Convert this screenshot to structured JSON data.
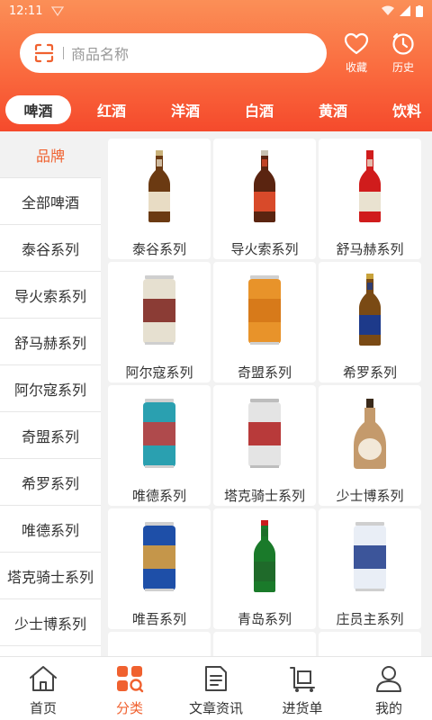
{
  "status_bar": {
    "time": "12:11"
  },
  "search": {
    "placeholder": "商品名称"
  },
  "top_actions": {
    "favorites": "收藏",
    "history": "历史"
  },
  "tabs": [
    {
      "label": "啤酒",
      "active": true
    },
    {
      "label": "红酒"
    },
    {
      "label": "洋酒"
    },
    {
      "label": "白酒"
    },
    {
      "label": "黄酒"
    },
    {
      "label": "饮料"
    }
  ],
  "sidenav": [
    {
      "label": "品牌",
      "active": true
    },
    {
      "label": "全部啤酒"
    },
    {
      "label": "泰谷系列"
    },
    {
      "label": "导火索系列"
    },
    {
      "label": "舒马赫系列"
    },
    {
      "label": "阿尔寇系列"
    },
    {
      "label": "奇盟系列"
    },
    {
      "label": "希罗系列"
    },
    {
      "label": "唯德系列"
    },
    {
      "label": "塔克骑士系列"
    },
    {
      "label": "少士博系列"
    }
  ],
  "products": [
    {
      "name": "泰谷系列",
      "kind": "bottle",
      "body": "#6b3a12",
      "label": "#e8dcc4",
      "cap": "#c9b27a"
    },
    {
      "name": "导火索系列",
      "kind": "bottle",
      "body": "#5a2410",
      "label": "#d84a2a",
      "cap": "#c7c0b0"
    },
    {
      "name": "舒马赫系列",
      "kind": "bottle",
      "body": "#d01c1c",
      "label": "#e9e2d0",
      "cap": "#d01c1c"
    },
    {
      "name": "阿尔寇系列",
      "kind": "can",
      "body": "#e6e0d0",
      "label": "#7a1f1a",
      "cap": "#cfcfcf"
    },
    {
      "name": "奇盟系列",
      "kind": "can",
      "body": "#e8932a",
      "label": "#d37618",
      "cap": "#cfcfcf"
    },
    {
      "name": "希罗系列",
      "kind": "bottle",
      "body": "#7a4a14",
      "label": "#1d3a8a",
      "cap": "#c8a23a"
    },
    {
      "name": "唯德系列",
      "kind": "can",
      "body": "#2aa0b0",
      "label": "#c73b3b",
      "cap": "#cfcfcf"
    },
    {
      "name": "塔克骑士系列",
      "kind": "can",
      "body": "#e4e4e4",
      "label": "#b01c1c",
      "cap": "#bdbdbd"
    },
    {
      "name": "少士博系列",
      "kind": "flask",
      "body": "#c49a6c",
      "label": "#f2e8d8",
      "cap": "#3a2a1a"
    },
    {
      "name": "唯吾系列",
      "kind": "can",
      "body": "#1e4fa8",
      "label": "#e3a23a",
      "cap": "#cfcfcf"
    },
    {
      "name": "青岛系列",
      "kind": "bottle",
      "body": "#1a7a2a",
      "label": "#1f6a2a",
      "cap": "#c81c1c"
    },
    {
      "name": "庄员主系列",
      "kind": "can",
      "body": "#e9eef6",
      "label": "#1d3a8a",
      "cap": "#cfcfcf"
    }
  ],
  "bottom_nav": [
    {
      "label": "首页",
      "icon": "home-icon"
    },
    {
      "label": "分类",
      "icon": "category-icon",
      "active": true
    },
    {
      "label": "文章资讯",
      "icon": "article-icon"
    },
    {
      "label": "进货单",
      "icon": "cart-icon"
    },
    {
      "label": "我的",
      "icon": "user-icon"
    }
  ],
  "colors": {
    "accent": "#f0612f",
    "header_top": "#fb8f57",
    "header_bottom": "#f54a2c"
  }
}
